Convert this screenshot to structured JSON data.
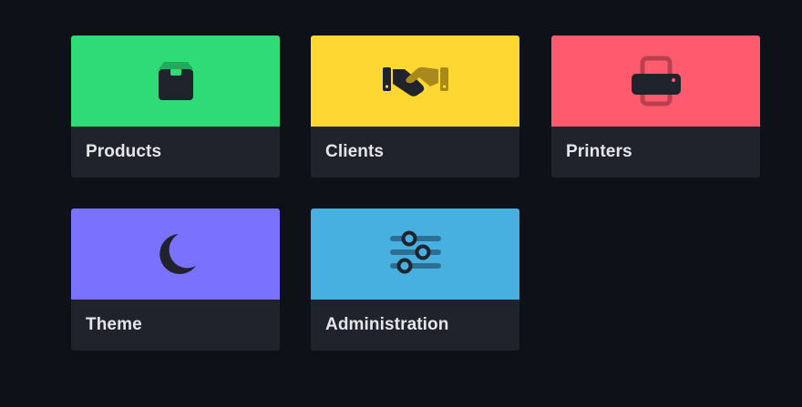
{
  "tiles": [
    {
      "label": "Products",
      "icon": "box-icon",
      "color": "#2fdb76"
    },
    {
      "label": "Clients",
      "icon": "handshake-icon",
      "color": "#ffd733"
    },
    {
      "label": "Printers",
      "icon": "printer-icon",
      "color": "#ff5a6e"
    },
    {
      "label": "Theme",
      "icon": "moon-icon",
      "color": "#7a72ff"
    },
    {
      "label": "Administration",
      "icon": "sliders-icon",
      "color": "#47b0e0"
    }
  ],
  "colors": {
    "background": "#0f1119",
    "tile_footer": "#20222c",
    "icon_dark": "#20222c"
  }
}
